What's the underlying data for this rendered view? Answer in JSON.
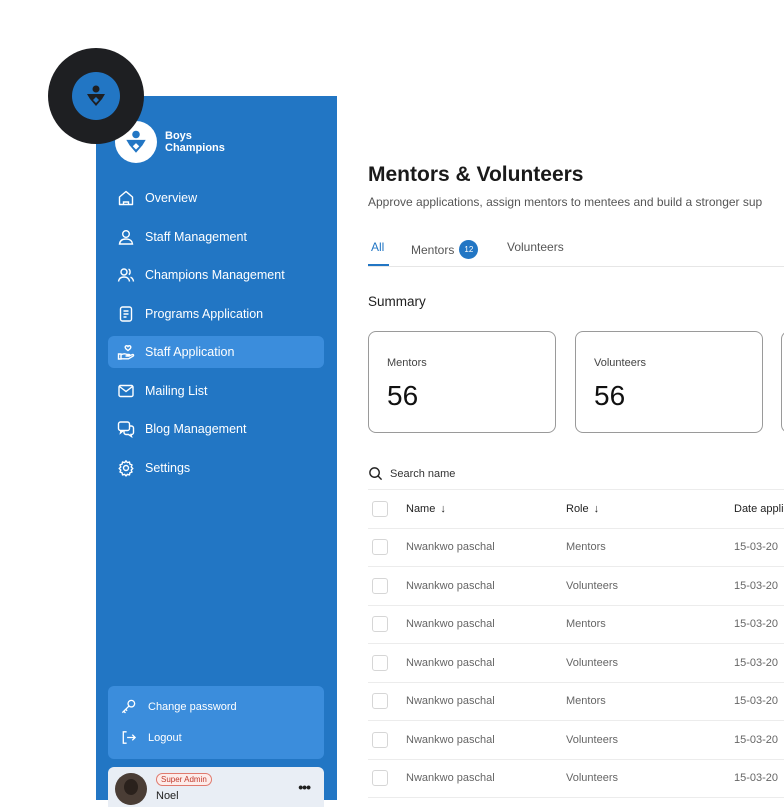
{
  "brand": {
    "line1": "Boys",
    "line2": "Champions"
  },
  "sidebar": {
    "items": [
      {
        "label": "Overview",
        "icon": "home-icon"
      },
      {
        "label": "Staff Management",
        "icon": "user-icon"
      },
      {
        "label": "Champions Management",
        "icon": "users-icon"
      },
      {
        "label": "Programs Application",
        "icon": "document-icon"
      },
      {
        "label": "Staff Application",
        "icon": "hand-heart-icon",
        "active": true
      },
      {
        "label": "Mailing List",
        "icon": "mail-icon"
      },
      {
        "label": "Blog Management",
        "icon": "chat-icon"
      },
      {
        "label": "Settings",
        "icon": "gear-icon"
      }
    ],
    "account": {
      "change_password": "Change password",
      "logout": "Logout"
    },
    "user": {
      "role": "Super Admin",
      "name": "Noel",
      "more": "•••"
    }
  },
  "main": {
    "title": "Mentors & Volunteers",
    "subtitle": "Approve applications, assign mentors to mentees and build a stronger sup",
    "tabs": {
      "all": "All",
      "mentors": "Mentors",
      "mentors_count": "12",
      "volunteers": "Volunteers"
    },
    "summary_heading": "Summary",
    "cards": [
      {
        "label": "Mentors",
        "value": "56"
      },
      {
        "label": "Volunteers",
        "value": "56"
      }
    ],
    "search_placeholder": "Search name",
    "table": {
      "headers": {
        "name": "Name",
        "role": "Role",
        "date": "Date appli"
      },
      "rows": [
        {
          "name": "Nwankwo paschal",
          "role": "Mentors",
          "date": "15-03-20"
        },
        {
          "name": "Nwankwo paschal",
          "role": "Volunteers",
          "date": "15-03-20"
        },
        {
          "name": "Nwankwo paschal",
          "role": "Mentors",
          "date": "15-03-20"
        },
        {
          "name": "Nwankwo paschal",
          "role": "Volunteers",
          "date": "15-03-20"
        },
        {
          "name": "Nwankwo paschal",
          "role": "Mentors",
          "date": "15-03-20"
        },
        {
          "name": "Nwankwo paschal",
          "role": "Volunteers",
          "date": "15-03-20"
        },
        {
          "name": "Nwankwo paschal",
          "role": "Volunteers",
          "date": "15-03-20"
        }
      ]
    }
  },
  "colors": {
    "primary": "#2276c4",
    "active_item": "#3b8ddc",
    "badge_bg": "#1e1f22"
  }
}
